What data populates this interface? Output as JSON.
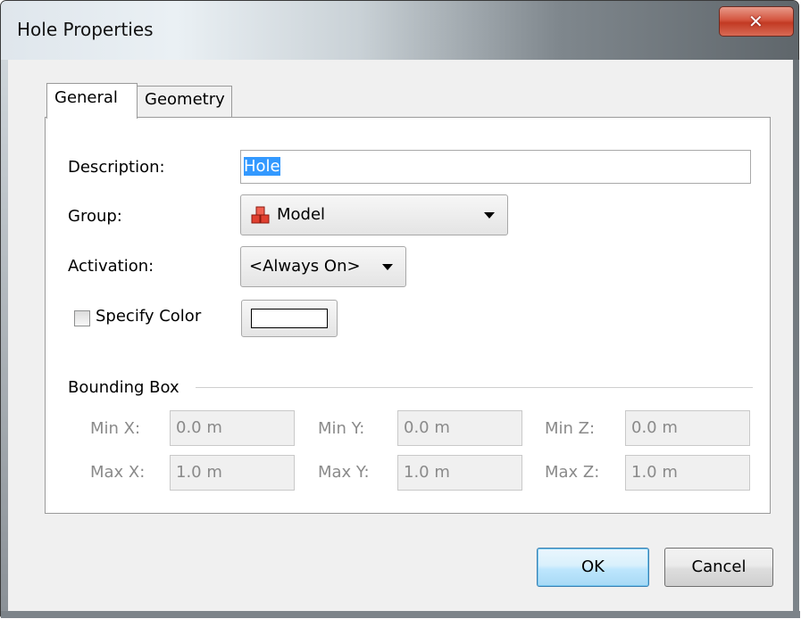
{
  "window": {
    "title": "Hole Properties",
    "close_glyph": "✕"
  },
  "tabs": [
    {
      "label": "General",
      "active": true
    },
    {
      "label": "Geometry",
      "active": false
    }
  ],
  "general": {
    "description_label": "Description:",
    "description_value": "Hole",
    "group_label": "Group:",
    "group_value": "Model",
    "group_icon": "model-blocks-icon",
    "activation_label": "Activation:",
    "activation_value": "<Always On>",
    "specify_color_label": "Specify Color",
    "specify_color_checked": false
  },
  "bounding_box": {
    "title": "Bounding Box",
    "min_x_label": "Min X:",
    "min_x": "0.0 m",
    "min_y_label": "Min Y:",
    "min_y": "0.0 m",
    "min_z_label": "Min Z:",
    "min_z": "0.0 m",
    "max_x_label": "Max X:",
    "max_x": "1.0 m",
    "max_y_label": "Max Y:",
    "max_y": "1.0 m",
    "max_z_label": "Max Z:",
    "max_z": "1.0 m"
  },
  "buttons": {
    "ok": "OK",
    "cancel": "Cancel"
  },
  "colors": {
    "selection": "#3399ff",
    "close_button": "#c23a23",
    "default_button_border": "#3c7fb1"
  }
}
